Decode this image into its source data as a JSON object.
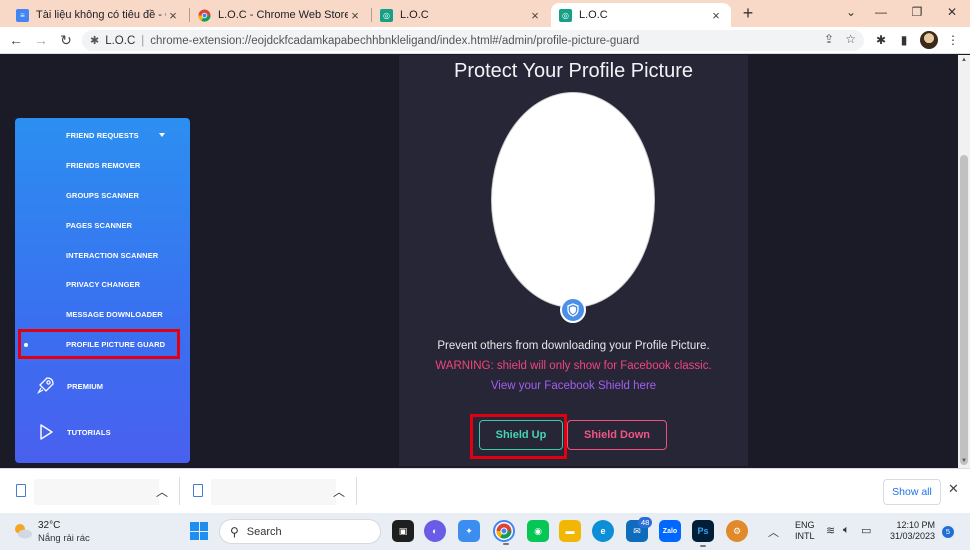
{
  "browser": {
    "tabs": [
      {
        "title": "Tài liệu không có tiêu đề - Google",
        "icon": "docs-icon",
        "active": false
      },
      {
        "title": "L.O.C - Chrome Web Store",
        "icon": "webstore-icon",
        "active": false
      },
      {
        "title": "L.O.C",
        "icon": "loc-icon",
        "active": false
      },
      {
        "title": "L.O.C",
        "icon": "loc-icon",
        "active": true
      }
    ],
    "new_tab_label": "+",
    "address": {
      "site_name": "L.O.C",
      "url": "chrome-extension://eojdckfcadamkapabechhbnkleligand/index.html#/admin/profile-picture-guard"
    }
  },
  "sidebar": {
    "items": [
      {
        "label": "FRIEND REQUESTS"
      },
      {
        "label": "FRIENDS REMOVER"
      },
      {
        "label": "GROUPS SCANNER"
      },
      {
        "label": "PAGES SCANNER"
      },
      {
        "label": "INTERACTION SCANNER"
      },
      {
        "label": "PRIVACY CHANGER"
      },
      {
        "label": "MESSAGE DOWNLOADER"
      },
      {
        "label": "PROFILE PICTURE GUARD"
      }
    ],
    "premium_label": "PREMIUM",
    "tutorials_label": "TUTORIALS"
  },
  "panel": {
    "title": "Protect Your Profile Picture",
    "description": "Prevent others from downloading your Profile Picture.",
    "warning": "WARNING: shield will only show for Facebook classic.",
    "link": "View your Facebook Shield here",
    "shield_up_label": "Shield Up",
    "shield_down_label": "Shield Down"
  },
  "downloads": {
    "show_all_label": "Show all"
  },
  "taskbar": {
    "weather_temp": "32°C",
    "weather_condition": "Nắng rải rác",
    "search_placeholder": "Search",
    "mail_badge": "48",
    "lang_line1": "ENG",
    "lang_line2": "INTL",
    "time": "12:10 PM",
    "date": "31/03/2023",
    "notifications": "5"
  },
  "colors": {
    "sidebar_top": "#2c8ff1",
    "sidebar_bottom": "#4960ef",
    "highlight": "#e00010",
    "shield_up": "#45d6b2",
    "shield_down": "#f25585",
    "warning": "#f2457a",
    "link": "#a35ef0"
  }
}
